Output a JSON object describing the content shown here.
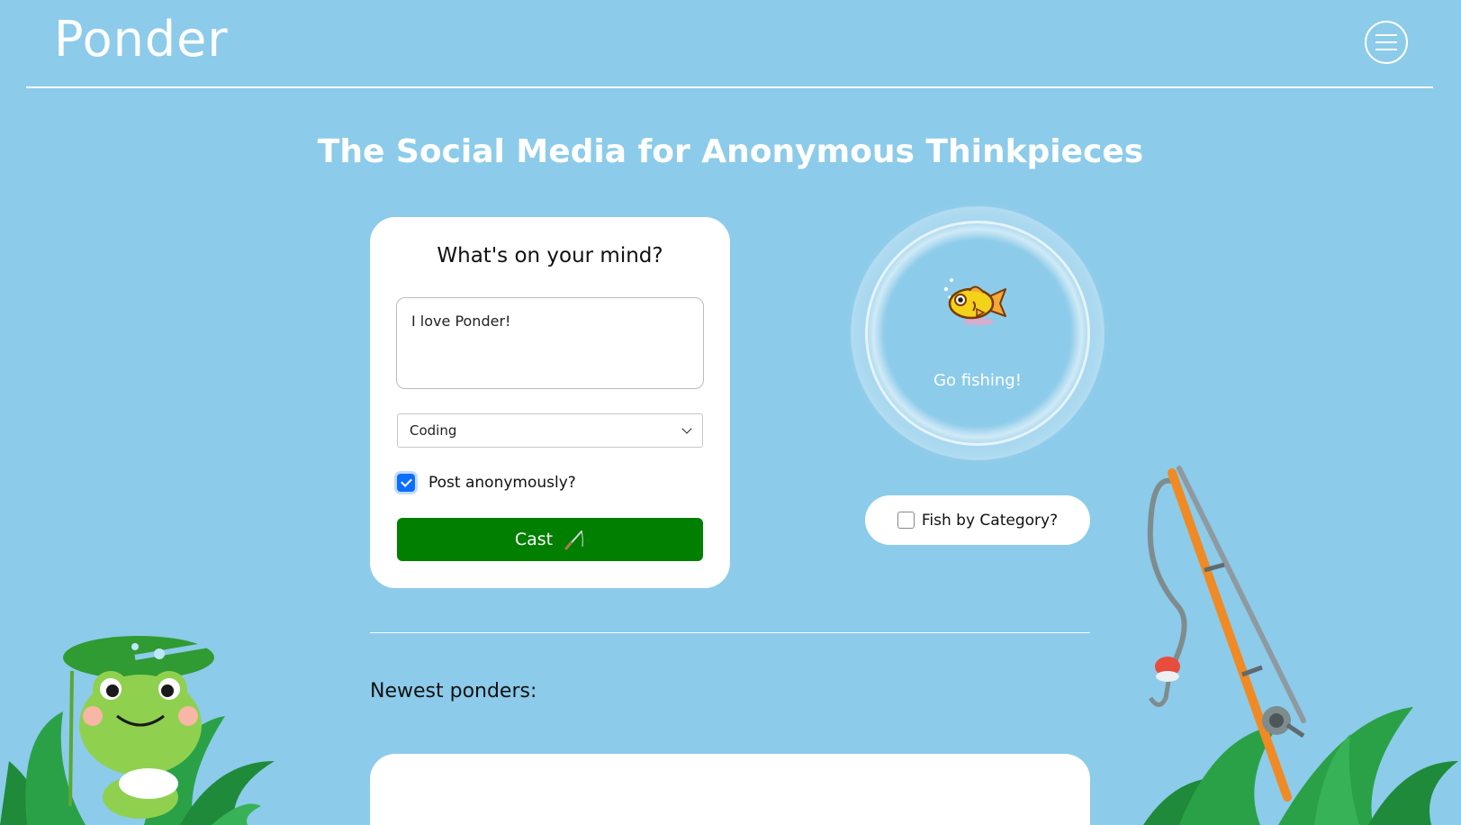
{
  "header": {
    "logo": "Ponder",
    "menu_icon": "hamburger-menu-icon"
  },
  "tagline": "The Social Media for Anonymous Thinkpieces",
  "composer": {
    "title": "What's on your mind?",
    "text_value": "I love Ponder!",
    "category_selected": "Coding",
    "anonymous_label": "Post anonymously?",
    "anonymous_checked": true,
    "cast_label": "Cast",
    "cast_icon": "fishing-rod-icon"
  },
  "fishing": {
    "button_label": "Go fishing!",
    "icon": "fish-icon",
    "category_label": "Fish by Category?",
    "category_checked": false
  },
  "feed": {
    "heading": "Newest ponders:"
  },
  "colors": {
    "background": "#8ccbea",
    "cast_button": "#007f00",
    "checkbox_accent": "#0d6efd"
  }
}
